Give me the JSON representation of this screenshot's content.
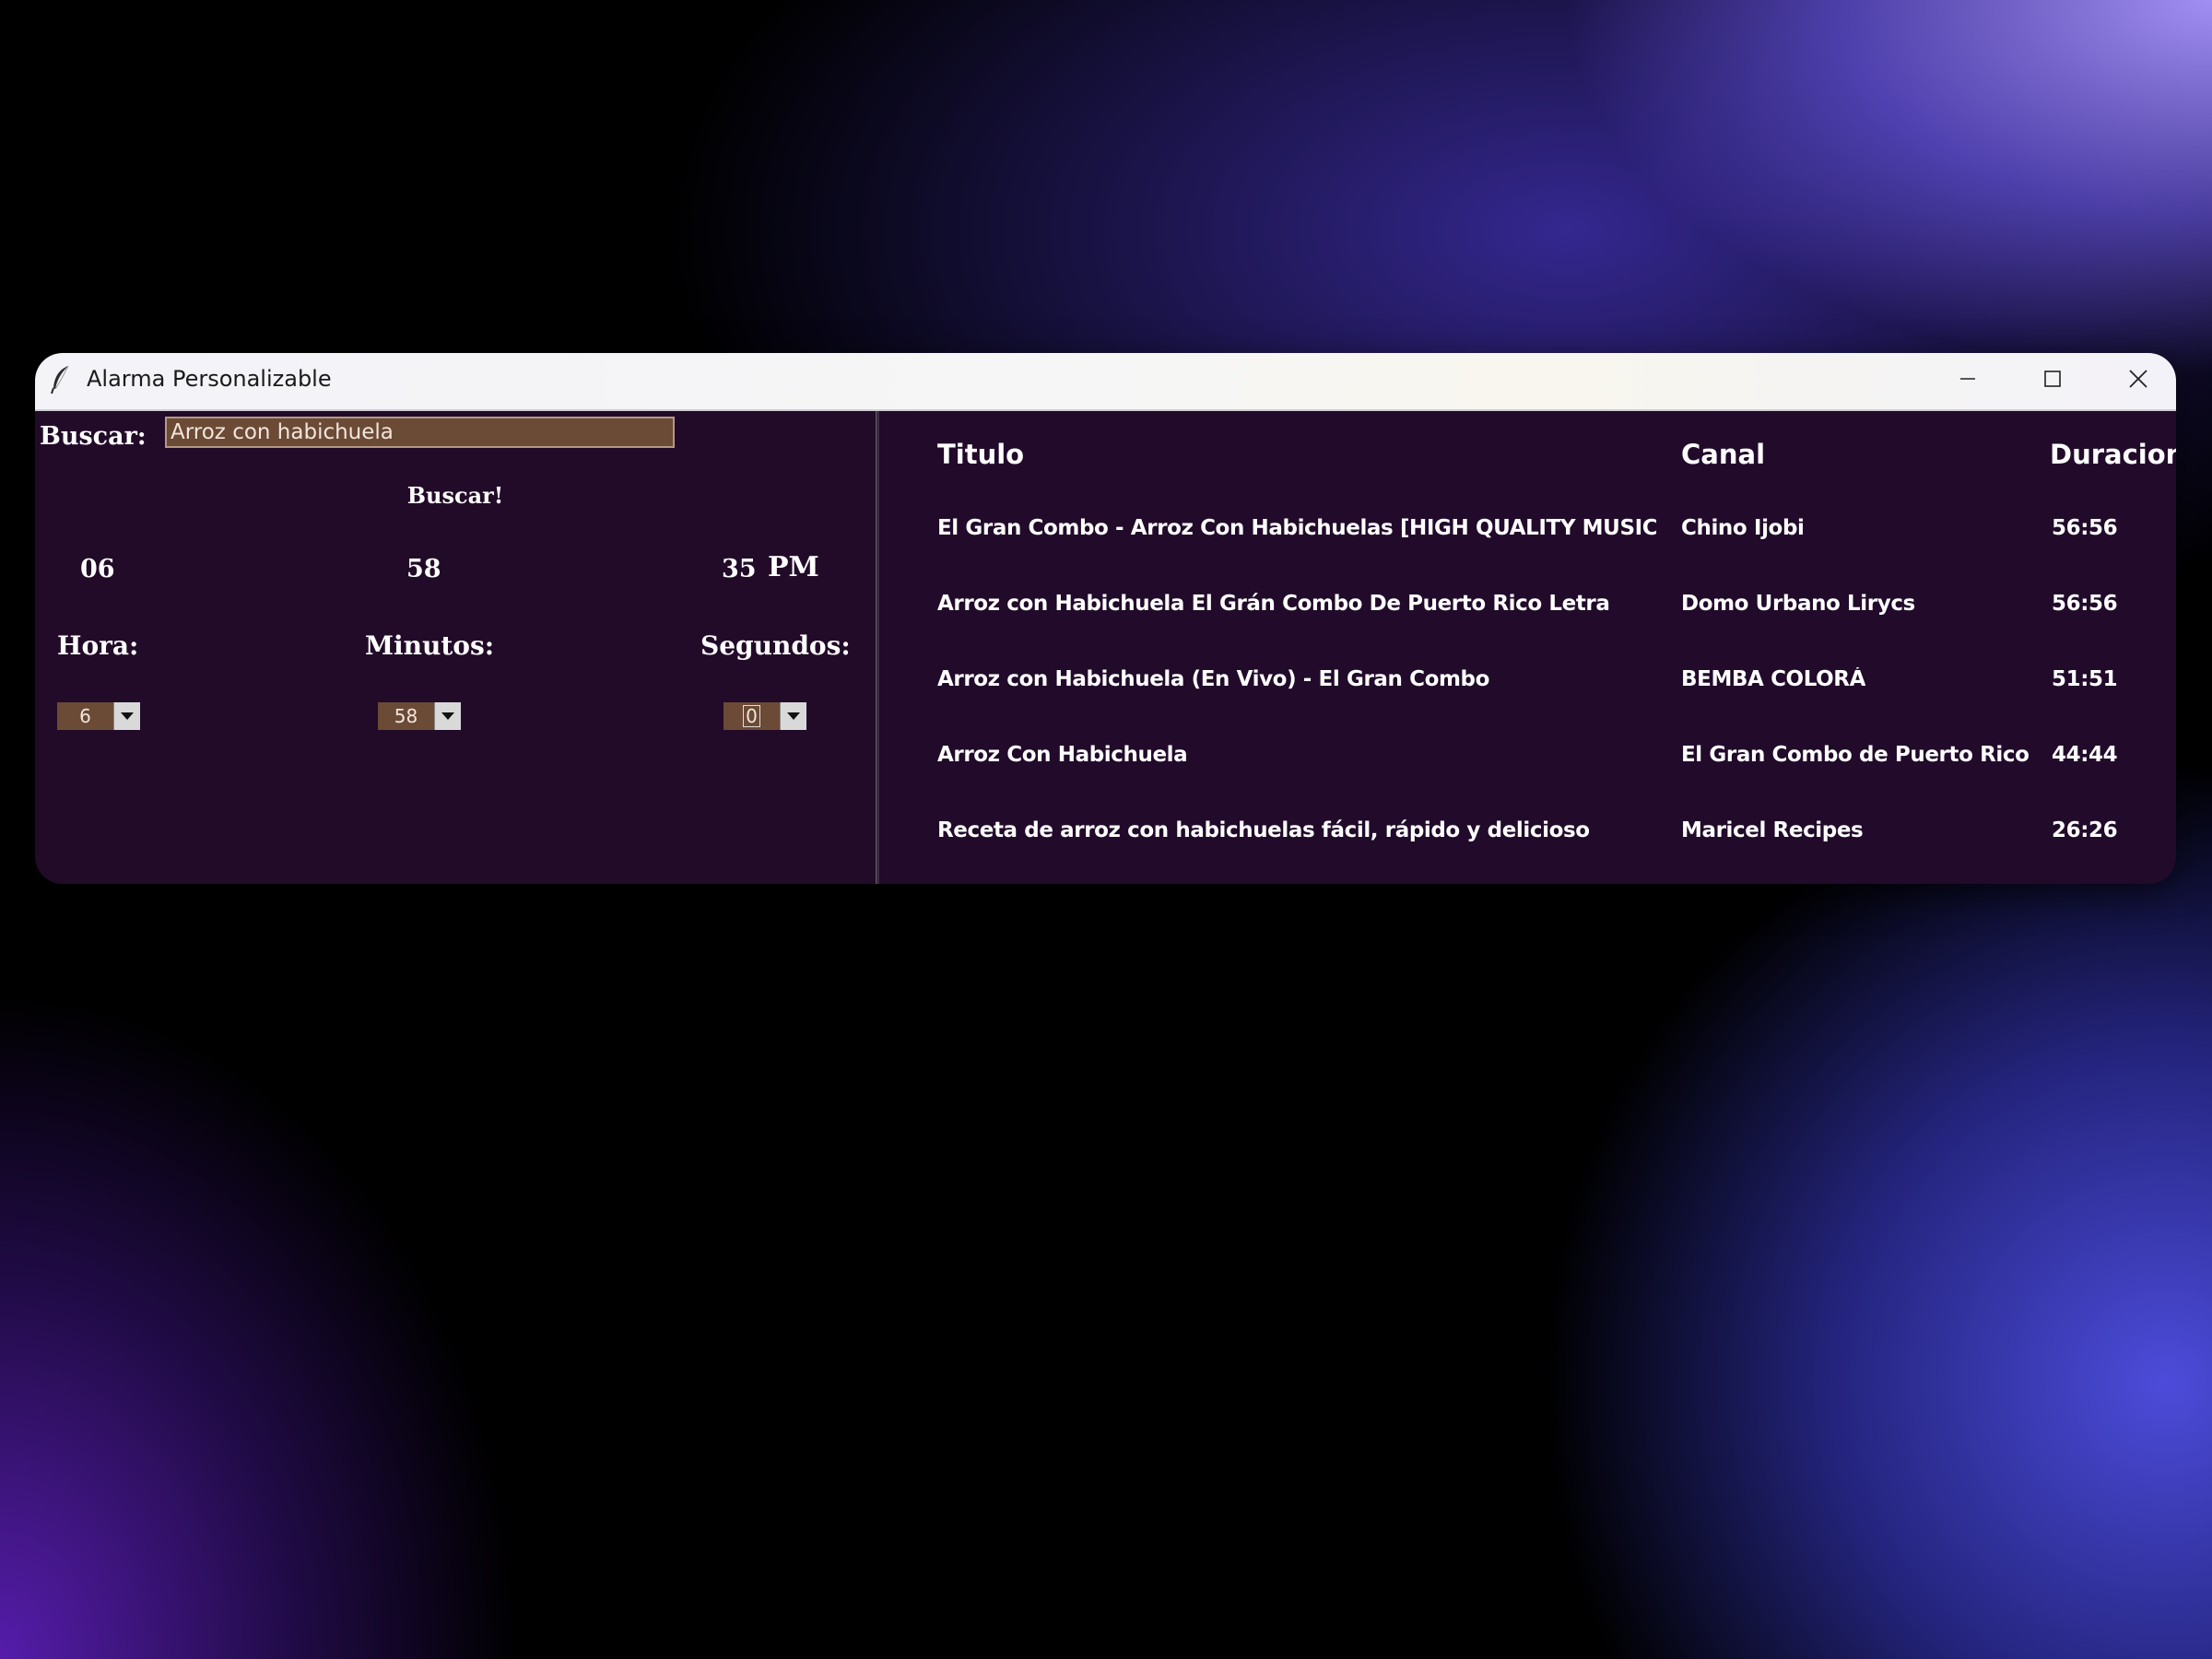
{
  "window": {
    "title": "Alarma Personalizable"
  },
  "search": {
    "label": "Buscar:",
    "value": "Arroz con habichuela",
    "button_label": "Buscar!"
  },
  "clock": {
    "hour": "06",
    "minute": "58",
    "second": "35",
    "period": "PM"
  },
  "alarm": {
    "hour_label": "Hora:",
    "minute_label": "Minutos:",
    "second_label": "Segundos:",
    "hour_value": "6",
    "minute_value": "58",
    "second_value": "0"
  },
  "results": {
    "columns": [
      "Titulo",
      "Canal",
      "Duracion"
    ],
    "rows": [
      {
        "title": "El Gran Combo - Arroz Con Habichuelas [HIGH QUALITY MUSIC]",
        "channel": "Chino Ijobi",
        "duration": "56:56"
      },
      {
        "title": "Arroz con Habichuela El Grán Combo De Puerto Rico Letra",
        "channel": "Domo Urbano Lirycs",
        "duration": "56:56"
      },
      {
        "title": "Arroz con Habichuela (En Vivo) - El Gran Combo",
        "channel": "BEMBA COLORÁ",
        "duration": "51:51"
      },
      {
        "title": "Arroz Con Habichuela",
        "channel": "El Gran Combo de Puerto Rico",
        "duration": "44:44"
      },
      {
        "title": "Receta de arroz con habichuelas fácil, rápido y delicioso",
        "channel": "Maricel Recipes",
        "duration": "26:26"
      }
    ]
  },
  "icons": {
    "app": "feather-icon",
    "minimize": "minimize-icon",
    "maximize": "maximize-icon",
    "close": "close-icon",
    "dropdown": "chevron-down-icon"
  },
  "colors": {
    "panel_bg": "#220b28",
    "input_bg": "#6b4a36",
    "text": "#ffffff"
  }
}
